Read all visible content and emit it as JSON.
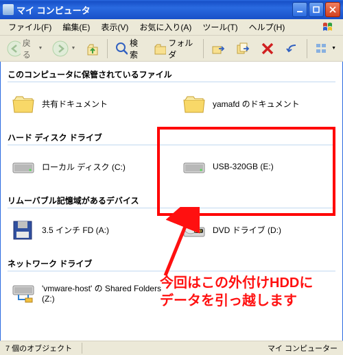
{
  "title": "マイ コンピュータ",
  "menus": {
    "file": "ファイル(F)",
    "edit": "編集(E)",
    "view": "表示(V)",
    "favorites": "お気に入り(A)",
    "tools": "ツール(T)",
    "help": "ヘルプ(H)"
  },
  "toolbar": {
    "back": "戻る",
    "search": "検索",
    "folders": "フォルダ"
  },
  "sections": {
    "stored_files": "このコンピュータに保管されているファイル",
    "hdd": "ハード ディスク ドライブ",
    "removable": "リムーバブル記憶域があるデバイス",
    "network": "ネットワーク ドライブ"
  },
  "items": {
    "shared_docs": "共有ドキュメント",
    "user_docs": "yamafd のドキュメント",
    "local_disk": "ローカル ディスク (C:)",
    "usb_disk": "USB-320GB (E:)",
    "floppy": "3.5 インチ FD (A:)",
    "dvd": "DVD ドライブ (D:)",
    "net_drive_a": "'vmware-host' の Shared Folders",
    "net_drive_b": "(Z:)"
  },
  "status": {
    "objects": "7 個のオブジェクト",
    "location": "マイ コンピューター"
  },
  "annotation": {
    "line1": "今回はこの外付けHDDに",
    "line2": "データを引っ越します"
  }
}
